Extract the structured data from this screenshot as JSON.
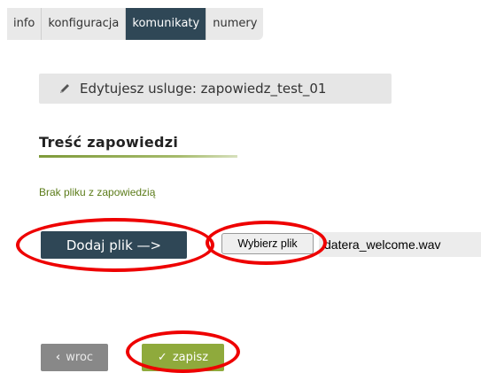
{
  "tabs": [
    {
      "label": "info",
      "active": false
    },
    {
      "label": "konfiguracja",
      "active": false
    },
    {
      "label": "komunikaty",
      "active": true
    },
    {
      "label": "numery",
      "active": false
    }
  ],
  "edit_banner": {
    "text": "Edytujesz usluge: zapowiedz_test_01",
    "icon": "pencil-icon"
  },
  "section": {
    "title": "Treść zapowiedzi"
  },
  "file_status": "Brak pliku z zapowiedzią",
  "upload": {
    "add_label": "Dodaj plik —>",
    "choose_label": "Wybierz plik",
    "file_name": "datera_welcome.wav"
  },
  "actions": {
    "back_label": "wroc",
    "back_icon": "chevron-left-icon",
    "save_label": "zapisz",
    "save_icon": "check-icon"
  },
  "colors": {
    "accent_dark": "#2f4756",
    "accent_green": "#8faa3c",
    "annotation_red": "#ee0000"
  }
}
